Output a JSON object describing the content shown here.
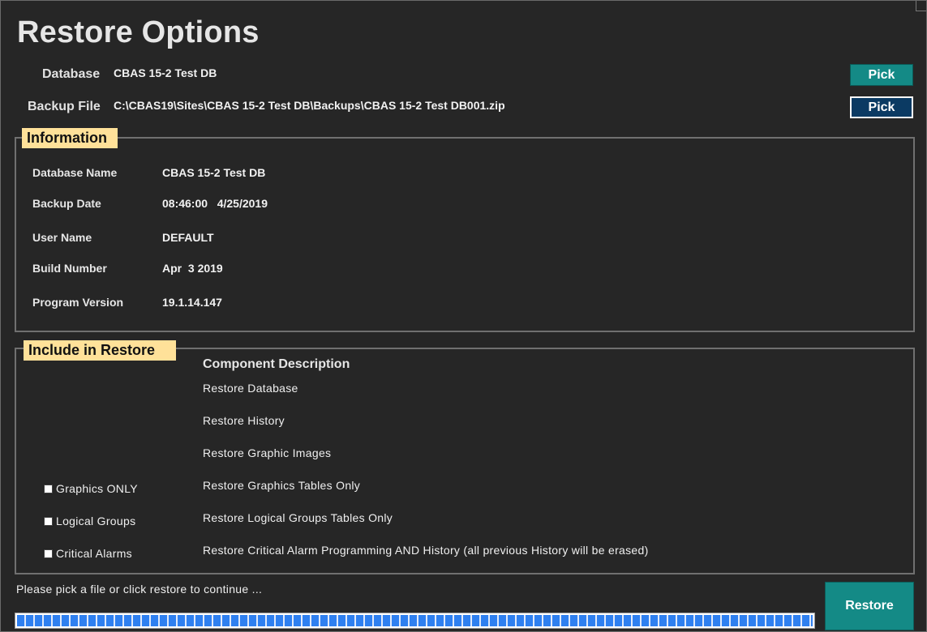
{
  "title": "Restore Options",
  "database": {
    "label": "Database",
    "value": "CBAS 15-2 Test DB",
    "pick_label": "Pick"
  },
  "backup_file": {
    "label": "Backup File",
    "value": "C:\\CBAS19\\Sites\\CBAS 15-2 Test DB\\Backups\\CBAS 15-2 Test DB001.zip",
    "pick_label": "Pick"
  },
  "information": {
    "legend": "Information",
    "rows": [
      {
        "label": "Database Name",
        "value": "CBAS 15-2 Test DB"
      },
      {
        "label": "Backup Date",
        "value": "08:46:00   4/25/2019"
      },
      {
        "label": "User Name",
        "value": "DEFAULT"
      },
      {
        "label": "Build Number",
        "value": "Apr  3 2019"
      },
      {
        "label": "Program Version",
        "value": "19.1.14.147"
      }
    ]
  },
  "include": {
    "legend": "Include in Restore",
    "header": "Component Description",
    "components": [
      "Restore Database",
      "Restore History",
      "Restore Graphic Images",
      "Restore Graphics Tables Only",
      "Restore Logical Groups Tables Only",
      "Restore Critical Alarm Programming AND History (all previous History will be erased)"
    ],
    "checkboxes": [
      {
        "label": "Graphics ONLY",
        "checked": false
      },
      {
        "label": "Logical Groups",
        "checked": false
      },
      {
        "label": "Critical Alarms",
        "checked": false
      }
    ]
  },
  "status": "Please pick a file or click restore to continue ...",
  "progress": {
    "percent": 100
  },
  "restore_label": "Restore",
  "colors": {
    "accent": "#148a86",
    "pick_dark": "#0b3a63",
    "legend_bg": "#ffe199",
    "progress": "#2f80f0"
  }
}
